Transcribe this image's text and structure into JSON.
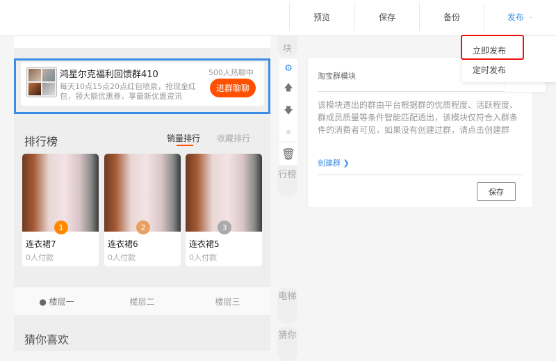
{
  "toolbar": {
    "preview": "预览",
    "save": "保存",
    "backup": "备份",
    "publish": "发布"
  },
  "publish_menu": {
    "items": [
      "立即发布",
      "定时发布"
    ],
    "highlighted": "立即发布"
  },
  "group_module": {
    "name": "鸿星尔克福利回馈群410",
    "description": "每天10点15点20点红包喷泉，抢现金红包，领大额优惠券，享最新优惠资讯",
    "hot": "500人热聊中",
    "join_label": "进群聊聊"
  },
  "ranking": {
    "title": "排行榜",
    "tabs": [
      "销量排行",
      "收藏排行"
    ],
    "active_tab": "销量排行",
    "products": [
      {
        "rank": "1",
        "name": "连衣裙7",
        "sold": "0人付款",
        "badge_color": "#ff8a00"
      },
      {
        "rank": "2",
        "name": "连衣裙6",
        "sold": "0人付款",
        "badge_color": "#e8a060"
      },
      {
        "rank": "3",
        "name": "连衣裙5",
        "sold": "0人付款",
        "badge_color": "#aaaaaa"
      }
    ]
  },
  "floors": [
    "楼层一",
    "楼层二",
    "楼层三"
  ],
  "guess_title": "猜你喜欢",
  "side_labels": {
    "module_tail": "块",
    "ranking": "行榜",
    "elevator": "电梯",
    "guess": "猜你"
  },
  "settings_panel": {
    "title": "淘宝群模块",
    "description": "该模块透出的群由平台根据群的优质程度、活跃程度、群成员质量等条件智能匹配透出，该模块仅符合入群条件的消费者可见，如果没有创建过群，请点击创建群",
    "link": "创建群",
    "save": "保存"
  },
  "colors": {
    "accent": "#3a8ee6",
    "brand": "#ff5000",
    "highlight": "#ee1111"
  }
}
